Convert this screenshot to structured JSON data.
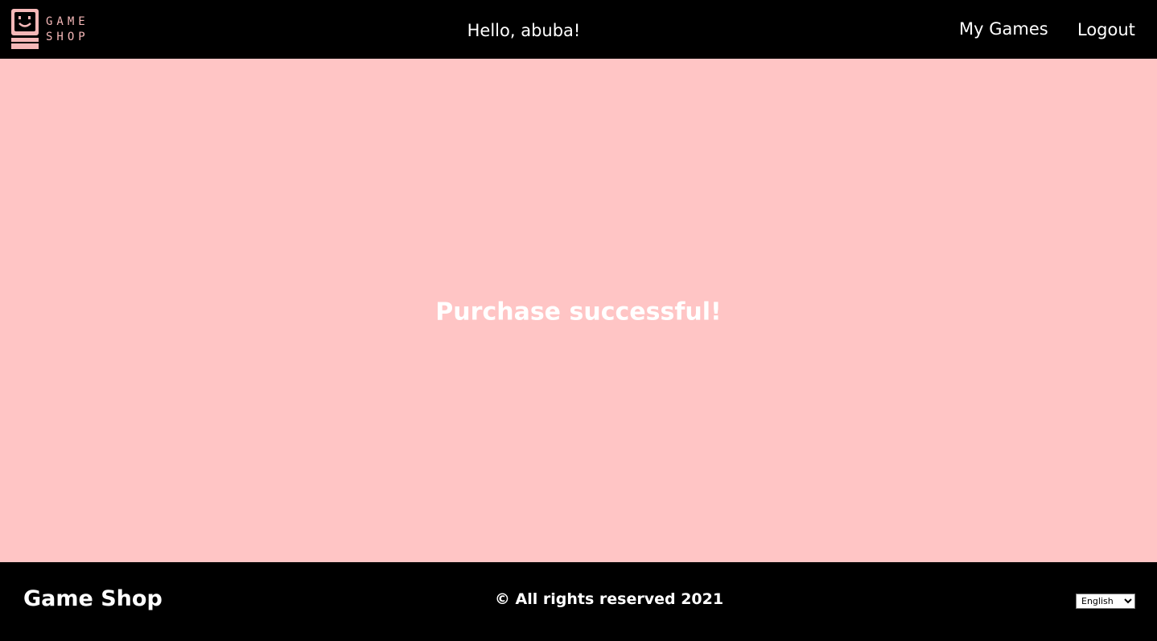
{
  "header": {
    "logo_text_line1": "GAME",
    "logo_text_line2": "SHOP",
    "greeting": "Hello, abuba!",
    "nav": {
      "my_games": "My Games",
      "logout": "Logout"
    }
  },
  "main": {
    "message": "Purchase successful!"
  },
  "footer": {
    "brand": "Game Shop",
    "copyright": "© All rights reserved 2021",
    "language": {
      "selected": "English"
    }
  },
  "colors": {
    "header_bg": "#000000",
    "main_bg": "#ffc5c5",
    "accent_pink": "#f5b8b8",
    "text": "#ffffff"
  }
}
